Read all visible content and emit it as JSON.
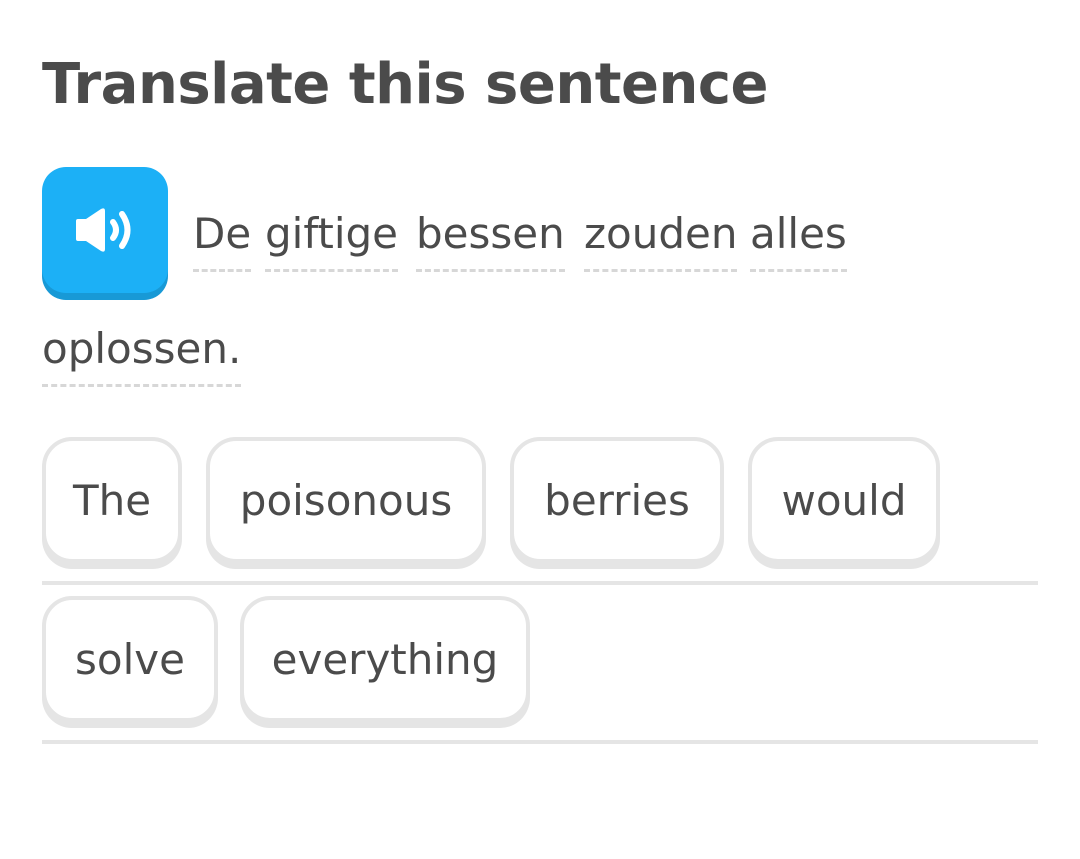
{
  "challenge": {
    "title": "Translate this sentence"
  },
  "audio": {
    "icon": "speaker-icon",
    "color": "#1cb0f6"
  },
  "prompt": {
    "words": [
      "De",
      "giftige",
      "bessen",
      "zouden",
      "alles",
      "oplossen."
    ]
  },
  "word_bank": {
    "words": [
      "The",
      "poisonous",
      "berries",
      "would",
      "solve",
      "everything"
    ]
  },
  "colors": {
    "text": "#4b4b4b",
    "border": "#e5e5e5",
    "accent": "#1cb0f6"
  }
}
